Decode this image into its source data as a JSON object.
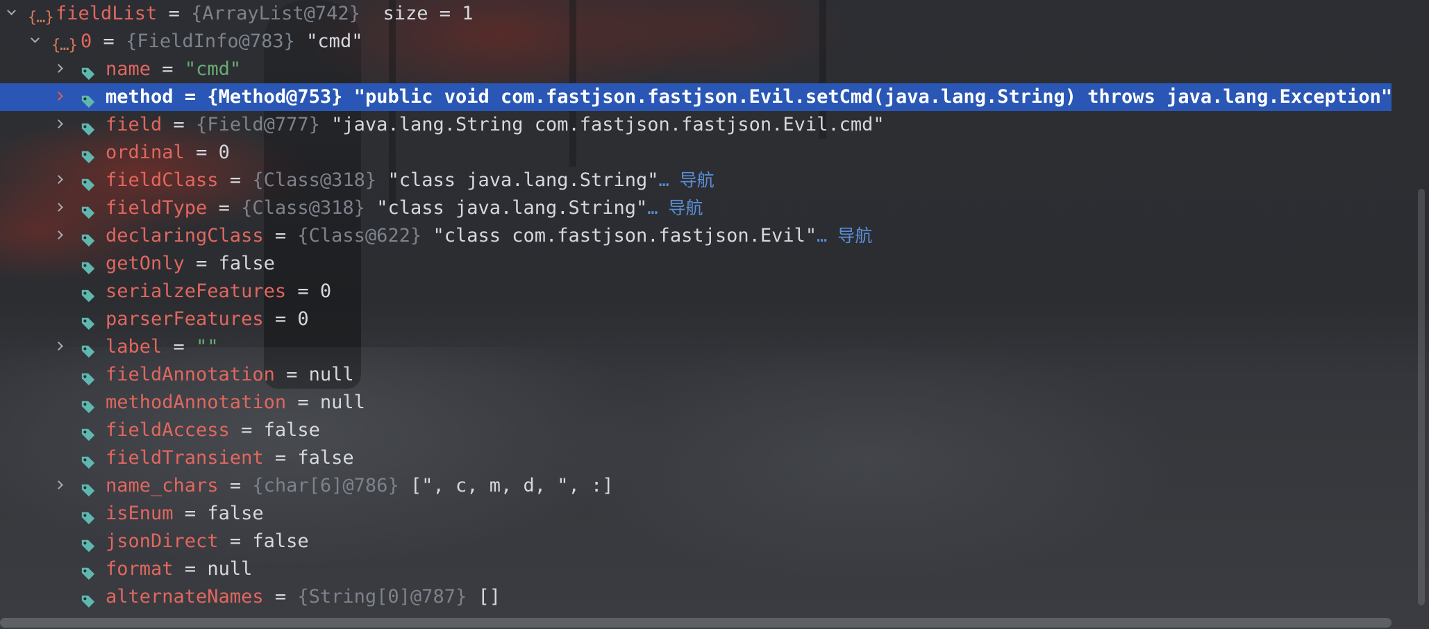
{
  "tree": {
    "root": {
      "name": "fieldList",
      "op": "=",
      "ref": "{ArrayList@742}",
      "size_text": "size = 1"
    },
    "element": {
      "name": "0",
      "op": "=",
      "ref": "{FieldInfo@783}",
      "value": "\"cmd\""
    },
    "fields": [
      {
        "name": "name",
        "op": "=",
        "ref": "",
        "value": "\"cmd\"",
        "value_kind": "string",
        "nav": ""
      },
      {
        "name": "method",
        "op": "=",
        "ref": "{Method@753}",
        "value": "\"public void com.fastjson.fastjson.Evil.setCmd(java.lang.String) throws java.lang.Exception\"",
        "value_kind": "plain",
        "nav": ""
      },
      {
        "name": "field",
        "op": "=",
        "ref": "{Field@777}",
        "value": "\"java.lang.String com.fastjson.fastjson.Evil.cmd\"",
        "value_kind": "plain",
        "nav": ""
      },
      {
        "name": "ordinal",
        "op": "=",
        "ref": "",
        "value": "0",
        "value_kind": "plain",
        "nav": ""
      },
      {
        "name": "fieldClass",
        "op": "=",
        "ref": "{Class@318}",
        "value": "\"class java.lang.String\"",
        "value_kind": "plain",
        "nav": "… 导航"
      },
      {
        "name": "fieldType",
        "op": "=",
        "ref": "{Class@318}",
        "value": "\"class java.lang.String\"",
        "value_kind": "plain",
        "nav": "… 导航"
      },
      {
        "name": "declaringClass",
        "op": "=",
        "ref": "{Class@622}",
        "value": "\"class com.fastjson.fastjson.Evil\"",
        "value_kind": "plain",
        "nav": "… 导航"
      },
      {
        "name": "getOnly",
        "op": "=",
        "ref": "",
        "value": "false",
        "value_kind": "plain",
        "nav": ""
      },
      {
        "name": "serialzeFeatures",
        "op": "=",
        "ref": "",
        "value": "0",
        "value_kind": "plain",
        "nav": ""
      },
      {
        "name": "parserFeatures",
        "op": "=",
        "ref": "",
        "value": "0",
        "value_kind": "plain",
        "nav": ""
      },
      {
        "name": "label",
        "op": "=",
        "ref": "",
        "value": "\"\"",
        "value_kind": "string",
        "nav": ""
      },
      {
        "name": "fieldAnnotation",
        "op": "=",
        "ref": "",
        "value": "null",
        "value_kind": "plain",
        "nav": ""
      },
      {
        "name": "methodAnnotation",
        "op": "=",
        "ref": "",
        "value": "null",
        "value_kind": "plain",
        "nav": ""
      },
      {
        "name": "fieldAccess",
        "op": "=",
        "ref": "",
        "value": "false",
        "value_kind": "plain",
        "nav": ""
      },
      {
        "name": "fieldTransient",
        "op": "=",
        "ref": "",
        "value": "false",
        "value_kind": "plain",
        "nav": ""
      },
      {
        "name": "name_chars",
        "op": "=",
        "ref": "{char[6]@786}",
        "value": "[\", c, m, d, \", :]",
        "value_kind": "plain",
        "nav": ""
      },
      {
        "name": "isEnum",
        "op": "=",
        "ref": "",
        "value": "false",
        "value_kind": "plain",
        "nav": ""
      },
      {
        "name": "jsonDirect",
        "op": "=",
        "ref": "",
        "value": "false",
        "value_kind": "plain",
        "nav": ""
      },
      {
        "name": "format",
        "op": "=",
        "ref": "",
        "value": "null",
        "value_kind": "plain",
        "nav": ""
      },
      {
        "name": "alternateNames",
        "op": "=",
        "ref": "{String[0]@787}",
        "value": "[]",
        "value_kind": "plain",
        "nav": ""
      }
    ]
  },
  "icons": {
    "object": "object-braces-icon",
    "field": "field-tag-icon",
    "expand": "chevron-right-icon",
    "collapse": "chevron-down-icon"
  },
  "colors": {
    "selection": "#2a57b5",
    "field_name": "#e1675f",
    "string": "#6aab73",
    "reference": "#7d828b",
    "nav_link": "#5b8ed6",
    "tag_icon": "#5fb8b0"
  }
}
